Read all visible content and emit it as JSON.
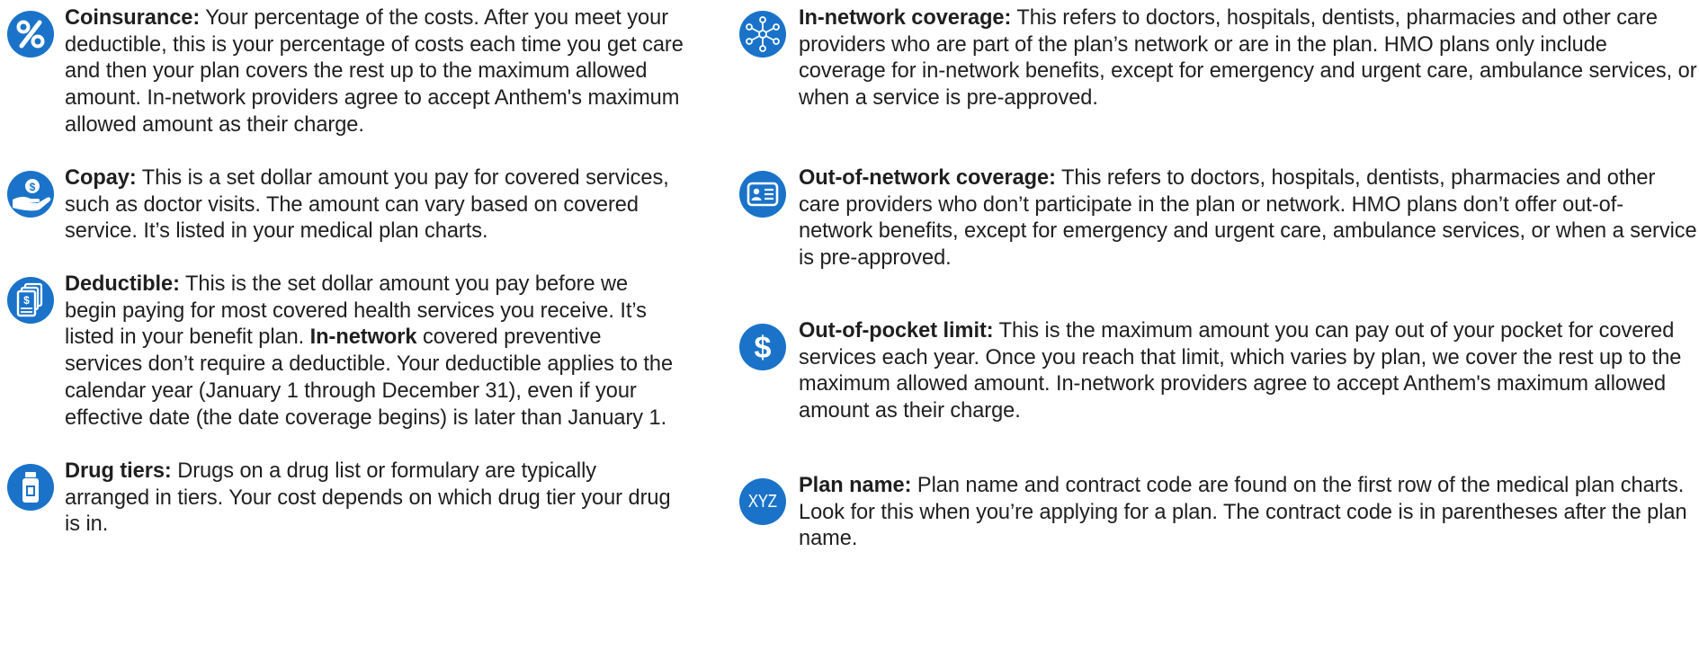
{
  "left_terms": [
    {
      "icon": "percent-icon",
      "name": "Coinsurance:",
      "body": "Your percentage of the costs. After you meet your deductible, this is your percentage of costs each time you get care and then your plan covers the rest up to the maximum allowed amount. In-network providers agree to accept Anthem's maximum allowed amount as their charge."
    },
    {
      "icon": "hand-dollar-icon",
      "name": "Copay:",
      "body": "This is a set dollar amount you pay for covered services, such as doctor visits. The amount can vary based on covered service. It’s listed in your medical plan charts."
    },
    {
      "icon": "dollar-document-icon",
      "name": "Deductible:",
      "body_before": "This is the set dollar amount you pay before we begin paying for most covered health services you receive. It’s listed in your benefit plan.  ",
      "body_bold": "In-network",
      "body_after": " covered preventive services don’t require a deductible. Your deductible applies to the calendar year (January 1 through December 31), even if your effective date (the date coverage begins) is later than January 1."
    },
    {
      "icon": "pill-bottle-icon",
      "name": "Drug tiers:",
      "body": "Drugs on a drug list or formulary are typically arranged in tiers. Your cost depends on which drug tier your drug is in."
    }
  ],
  "right_terms": [
    {
      "icon": "network-icon",
      "name": "In-network coverage:",
      "body": "This refers to doctors, hospitals, dentists, pharmacies and other care providers who are part of the plan’s network or are in the plan.  HMO plans only include coverage for in-network benefits, except for emergency and urgent care, ambulance services, or when a service is pre-approved."
    },
    {
      "icon": "id-card-icon",
      "name": "Out-of-network coverage:",
      "body": "This refers to doctors, hospitals, dentists, pharmacies and other care providers who don’t participate in the plan or network. HMO plans don’t offer out-of-network benefits, except for emergency and urgent care, ambulance services, or when a service is pre-approved."
    },
    {
      "icon": "dollar-sign-icon",
      "name": "Out-of-pocket limit:",
      "body": "This is the maximum amount you can pay out of your pocket for covered services each year. Once you reach that limit, which varies by plan, we cover the rest up to the maximum allowed amount. In-network providers agree to accept Anthem's maximum allowed amount as their charge."
    },
    {
      "icon": "xyz-icon",
      "icon_text": "XYZ",
      "name": "Plan name:",
      "body": "Plan name and contract code are found on the first row of the medical plan charts. Look for this when you’re applying for a plan. The contract code is in parentheses after the plan name."
    }
  ],
  "colors": {
    "icon_blue": "#1a73c9",
    "text": "#1f1f1f"
  }
}
